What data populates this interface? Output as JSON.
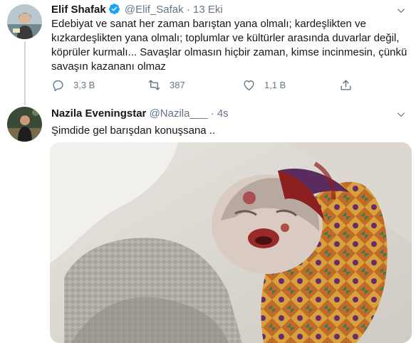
{
  "tweet1": {
    "name": "Elif Shafak",
    "handle": "@Elif_Safak",
    "separator": "·",
    "time": "13 Eki",
    "lines": [
      "Edebiyat ve sanat her zaman barıştan yana olmalı; kardeşlikten ve",
      "kızkardeşlikten yana olmalı; toplumlar ve kültürler arasında duvarlar değil,",
      "köprüler kurmalı...  Savaşlar olmasın hiçbir zaman, kimse incinmesin, çünkü",
      "savaşın kazananı olmaz"
    ],
    "replies": "3,3 B",
    "retweets": "387",
    "likes": "1,1 B"
  },
  "tweet2": {
    "name": "Nazila Eveningstar",
    "handle": "@Nazila___",
    "separator": "·",
    "time": "4s",
    "text": "Şimdide gel barışdan konuşsana .."
  },
  "colors": {
    "text": "#14171a",
    "secondary": "#657786",
    "verified": "#1da1f2",
    "line": "#ccd6dd"
  }
}
